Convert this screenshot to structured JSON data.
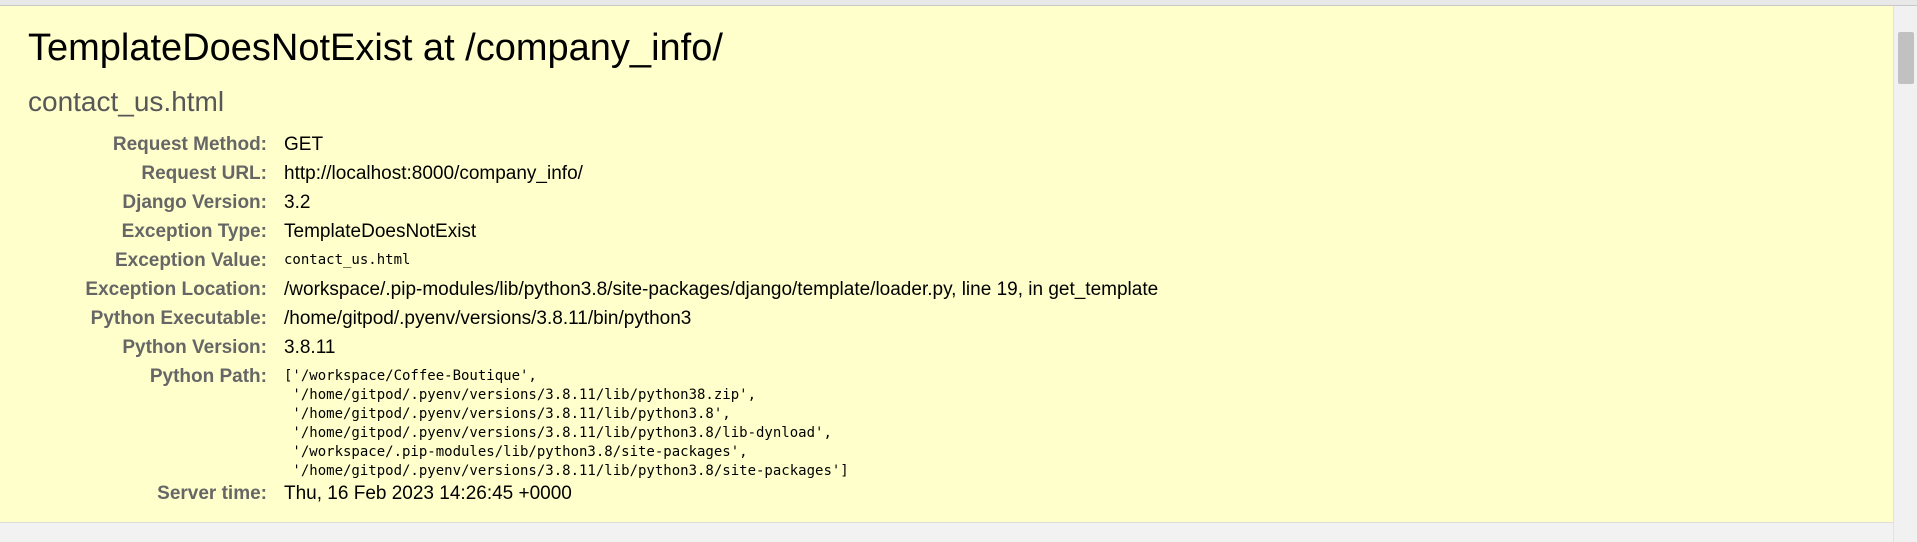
{
  "error": {
    "title": "TemplateDoesNotExist at /company_info/",
    "subtitle": "contact_us.html"
  },
  "meta": {
    "request_method": {
      "label": "Request Method:",
      "value": "GET"
    },
    "request_url": {
      "label": "Request URL:",
      "value": "http://localhost:8000/company_info/"
    },
    "django_version": {
      "label": "Django Version:",
      "value": "3.2"
    },
    "exception_type": {
      "label": "Exception Type:",
      "value": "TemplateDoesNotExist"
    },
    "exception_value": {
      "label": "Exception Value:",
      "value": "contact_us.html"
    },
    "exception_location": {
      "label": "Exception Location:",
      "value": "/workspace/.pip-modules/lib/python3.8/site-packages/django/template/loader.py, line 19, in get_template"
    },
    "python_executable": {
      "label": "Python Executable:",
      "value": "/home/gitpod/.pyenv/versions/3.8.11/bin/python3"
    },
    "python_version": {
      "label": "Python Version:",
      "value": "3.8.11"
    },
    "python_path": {
      "label": "Python Path:",
      "lines": [
        "['/workspace/Coffee-Boutique',",
        " '/home/gitpod/.pyenv/versions/3.8.11/lib/python38.zip',",
        " '/home/gitpod/.pyenv/versions/3.8.11/lib/python3.8',",
        " '/home/gitpod/.pyenv/versions/3.8.11/lib/python3.8/lib-dynload',",
        " '/workspace/.pip-modules/lib/python3.8/site-packages',",
        " '/home/gitpod/.pyenv/versions/3.8.11/lib/python3.8/site-packages']"
      ]
    },
    "server_time": {
      "label": "Server time:",
      "value": "Thu, 16 Feb 2023 14:26:45 +0000"
    }
  },
  "colors": {
    "background": "#ffffcc",
    "label": "#666666",
    "subtitle": "#575757"
  }
}
